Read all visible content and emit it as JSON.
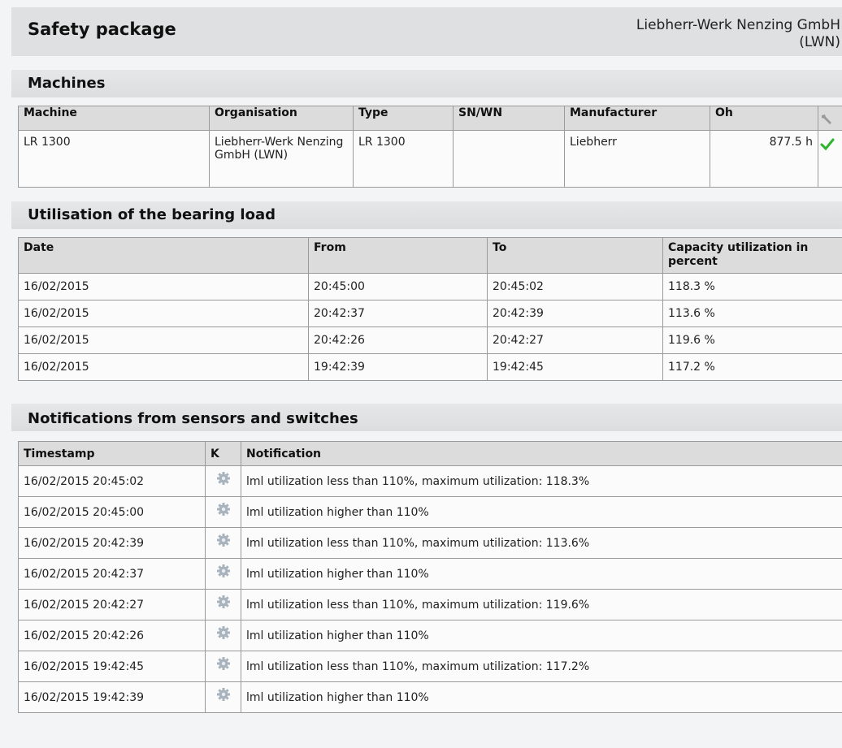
{
  "header": {
    "title": "Safety package",
    "org_line1": "Liebherr-Werk Nenzing GmbH",
    "org_line2": "(LWN)"
  },
  "machines": {
    "section_title": "Machines",
    "columns": {
      "machine": "Machine",
      "organisation": "Organisation",
      "type": "Type",
      "sn": "SN/WN",
      "manufacturer": "Manufacturer",
      "oh": "Oh"
    },
    "header_icon": "wrench-icon",
    "rows": [
      {
        "machine": "LR 1300",
        "organisation": "Liebherr-Werk Nenzing GmbH (LWN)",
        "type": "LR 1300",
        "sn": "",
        "manufacturer": "Liebherr",
        "oh": "877.5 h",
        "status_icon": "checkmark-icon",
        "status_color": "#2db52d"
      }
    ]
  },
  "bearing": {
    "section_title": "Utilisation of the bearing load",
    "columns": {
      "date": "Date",
      "from": "From",
      "to": "To",
      "capacity": "Capacity utilization in percent"
    },
    "rows": [
      {
        "date": "16/02/2015",
        "from": "20:45:00",
        "to": "20:45:02",
        "capacity": "118.3 %"
      },
      {
        "date": "16/02/2015",
        "from": "20:42:37",
        "to": "20:42:39",
        "capacity": "113.6 %"
      },
      {
        "date": "16/02/2015",
        "from": "20:42:26",
        "to": "20:42:27",
        "capacity": "119.6 %"
      },
      {
        "date": "16/02/2015",
        "from": "19:42:39",
        "to": "19:42:45",
        "capacity": "117.2 %"
      }
    ]
  },
  "notifications": {
    "section_title": "Notifications from sensors and switches",
    "columns": {
      "timestamp": "Timestamp",
      "k": "K",
      "notification": "Notification"
    },
    "row_icon": "gear-icon",
    "rows": [
      {
        "timestamp": "16/02/2015 20:45:02",
        "text": "lml utilization less than 110%, maximum utilization: 118.3%"
      },
      {
        "timestamp": "16/02/2015 20:45:00",
        "text": "lml utilization higher than 110%"
      },
      {
        "timestamp": "16/02/2015 20:42:39",
        "text": "lml utilization less than 110%, maximum utilization: 113.6%"
      },
      {
        "timestamp": "16/02/2015 20:42:37",
        "text": "lml utilization higher than 110%"
      },
      {
        "timestamp": "16/02/2015 20:42:27",
        "text": "lml utilization less than 110%, maximum utilization: 119.6%"
      },
      {
        "timestamp": "16/02/2015 20:42:26",
        "text": "lml utilization higher than 110%"
      },
      {
        "timestamp": "16/02/2015 19:42:45",
        "text": "lml utilization less than 110%, maximum utilization: 117.2%"
      },
      {
        "timestamp": "16/02/2015 19:42:39",
        "text": "lml utilization higher than 110%"
      }
    ]
  }
}
